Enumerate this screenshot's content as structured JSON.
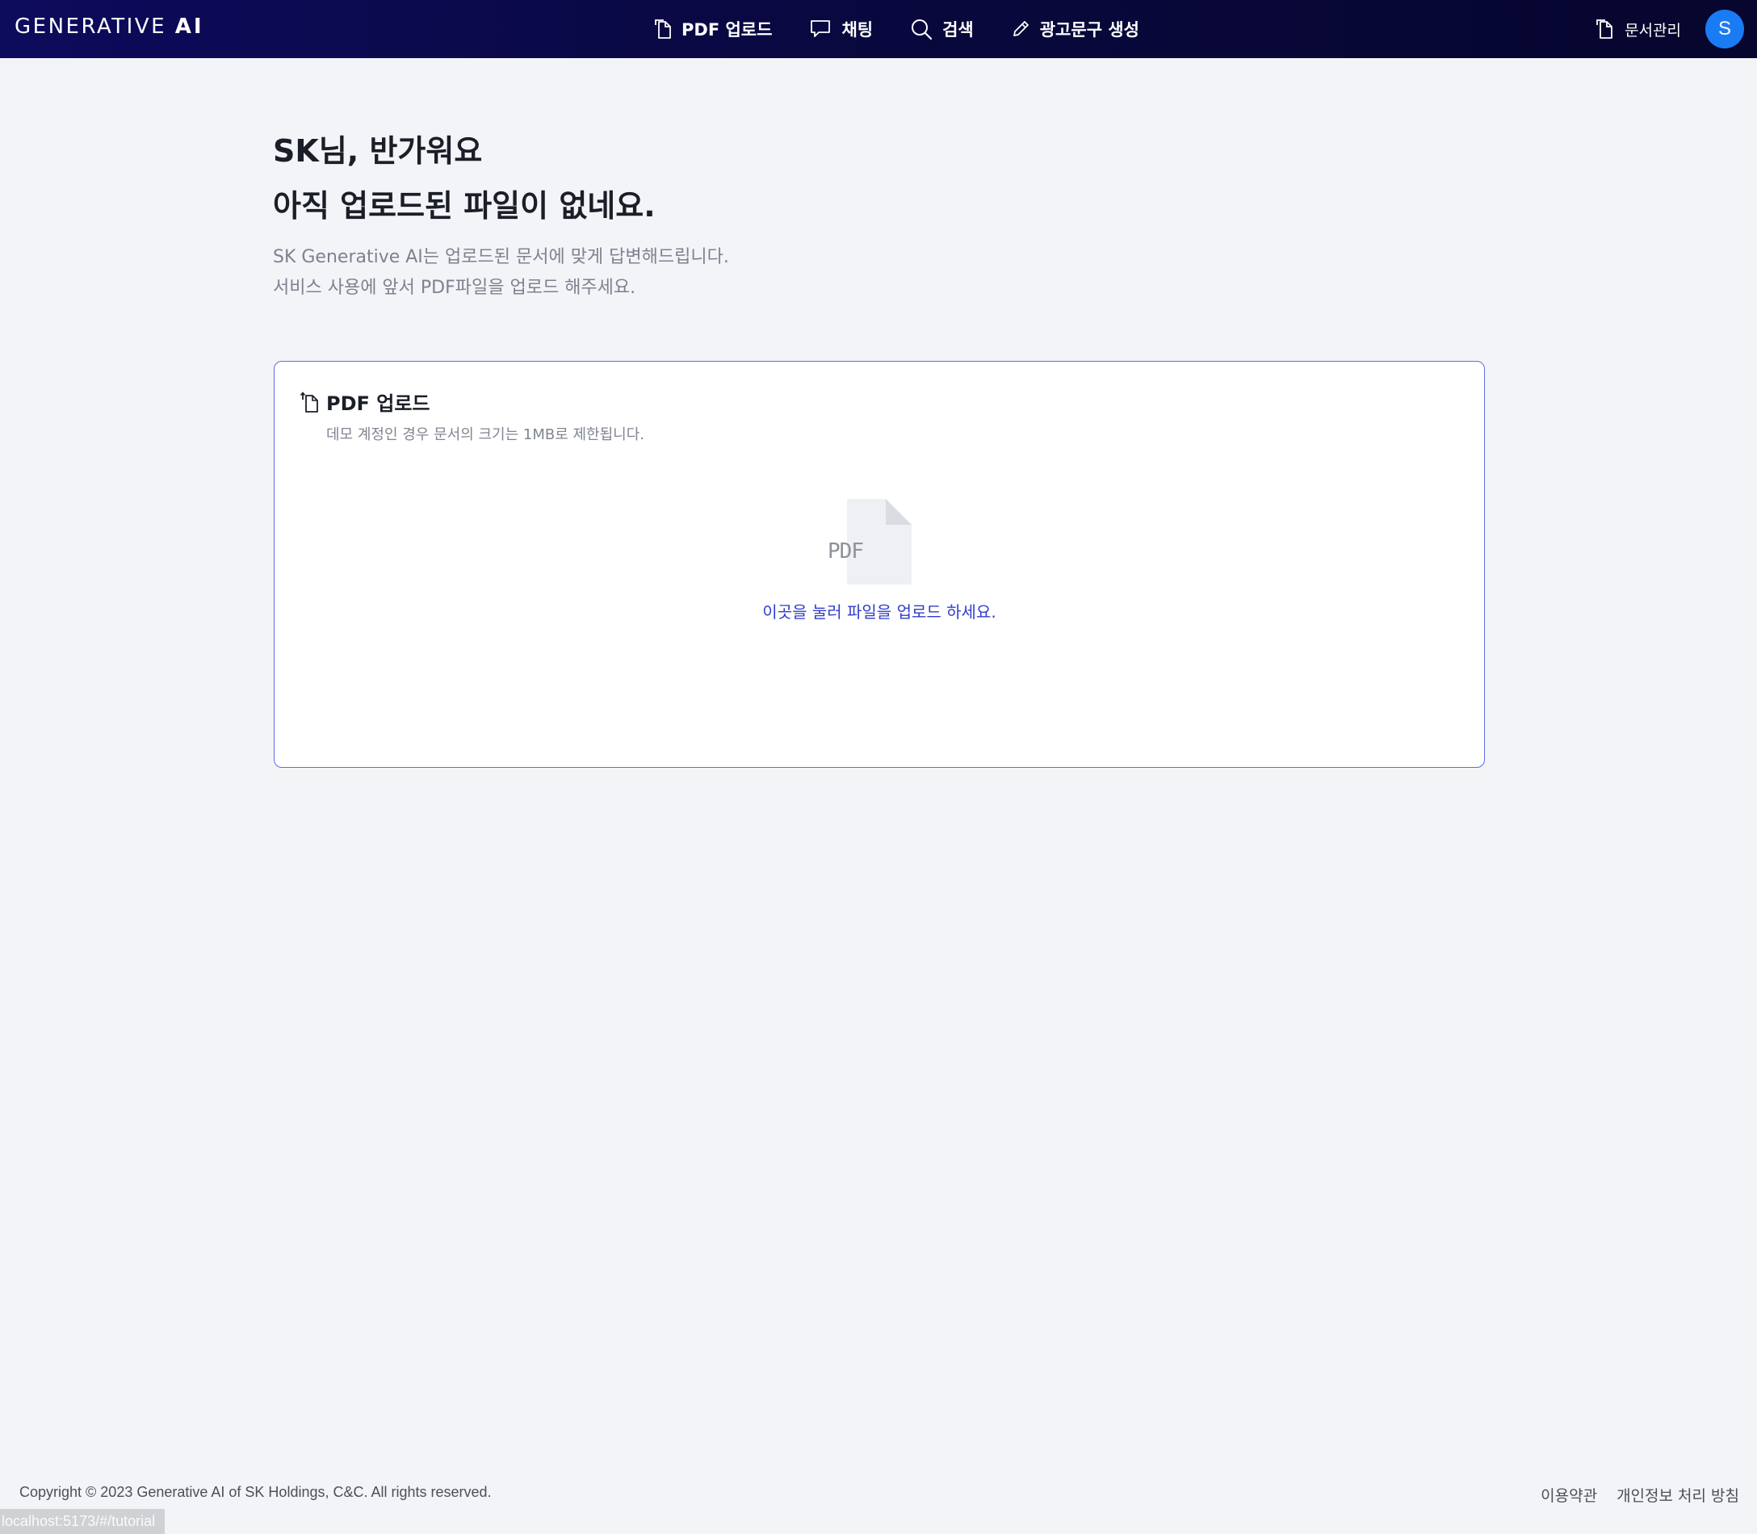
{
  "header": {
    "logo_text": "GENERATIVE ",
    "logo_ai": "AI",
    "nav": [
      {
        "label": "PDF 업로드",
        "icon": "document-icon"
      },
      {
        "label": "채팅",
        "icon": "chat-bubble-icon"
      },
      {
        "label": "검색",
        "icon": "search-icon"
      },
      {
        "label": "광고문구 생성",
        "icon": "pencil-icon"
      }
    ],
    "doc_manage_label": "문서관리",
    "avatar_letter": "S"
  },
  "main": {
    "greeting": "SK님, 반가워요",
    "no_files": "아직 업로드된 파일이 없네요.",
    "desc_line1": "SK Generative AI는 업로드된 문서에 맞게 답변해드립니다.",
    "desc_line2": "서비스 사용에 앞서 PDF파일을 업로드 해주세요."
  },
  "upload_card": {
    "title": "PDF 업로드",
    "note": "데모 계정인 경우 문서의 크기는 1MB로 제한됩니다.",
    "file_icon_label": "PDF",
    "drop_text": "이곳을 눌러 파일을 업로드 하세요."
  },
  "footer": {
    "copyright": "Copyright © 2023 Generative AI of SK Holdings, C&C. All rights reserved.",
    "links": [
      "이용약관",
      "개인정보 처리 방침"
    ]
  },
  "status_bar": {
    "url": "localhost:5173/#/tutorial"
  },
  "colors": {
    "header_bg": "#0d0b5c",
    "accent": "#5c6ee6",
    "link": "#2f3ec9",
    "avatar": "#1a7cf5",
    "page_bg": "#f3f4f7"
  }
}
